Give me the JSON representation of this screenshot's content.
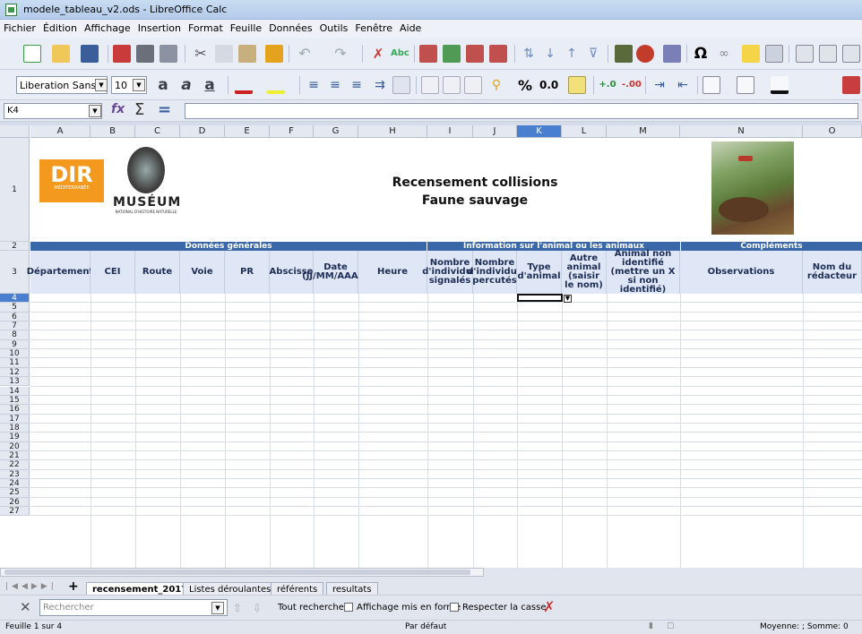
{
  "window": {
    "title": "modele_tableau_v2.ods - LibreOffice Calc"
  },
  "menu": [
    "Fichier",
    "Édition",
    "Affichage",
    "Insertion",
    "Format",
    "Feuille",
    "Données",
    "Outils",
    "Fenêtre",
    "Aide"
  ],
  "format_toolbar": {
    "font_name": "Liberation Sans",
    "font_size": "10",
    "percent_label": "%",
    "number_label": "0.0"
  },
  "formula_bar": {
    "cell_ref": "K4",
    "content": ""
  },
  "columns": [
    "A",
    "B",
    "C",
    "D",
    "E",
    "F",
    "G",
    "H",
    "I",
    "J",
    "K",
    "L",
    "M",
    "N",
    "O"
  ],
  "row_numbers": [
    "1",
    "2",
    "3",
    "4",
    "5",
    "6",
    "7",
    "8",
    "9",
    "10",
    "11",
    "12",
    "13",
    "14",
    "15",
    "16",
    "17",
    "18",
    "19",
    "20",
    "21",
    "22",
    "23",
    "24",
    "25",
    "26",
    "27"
  ],
  "sheet": {
    "title_line1": "Recensement collisions",
    "title_line2": "Faune sauvage",
    "logo_dir": "DIR",
    "logo_dir_sub": "MÉDITERRANÉE",
    "logo_museum": "MUSÉUM",
    "logo_museum_sub": "NATIONAL D'HISTOIRE NATURELLE",
    "section_general": "Données générales",
    "section_animal": "Information sur l'animal ou les animaux",
    "section_complements": "Compléments",
    "headers": [
      "Département",
      "CEI",
      "Route",
      "Voie",
      "PR",
      "Abscisse",
      "Date (JJ/MM/AAAA)",
      "Heure",
      "Nombre d'individus signalés",
      "Nombre d'individus percutés",
      "Type d'animal",
      "Autre animal (saisir le nom)",
      "Animal non identifié (mettre un X si non identifié)",
      "Observations",
      "Nom du rédacteur"
    ]
  },
  "sheet_tabs": [
    "recensement_2017",
    "Listes déroulantes",
    "référents",
    "resultats"
  ],
  "active_tab": "recensement_2017",
  "find": {
    "placeholder": "Rechercher",
    "find_all": "Tout rechercher",
    "formatted_display": "Affichage mis en forme",
    "match_case": "Respecter la casse"
  },
  "status": {
    "sheet": "Feuille 1 sur 4",
    "style": "Par défaut",
    "summary": "Moyenne: ; Somme: 0"
  },
  "colors": {
    "header_band": "#3a67a8",
    "header_bg": "#dfe6f6",
    "dir_orange": "#f39a1e"
  }
}
